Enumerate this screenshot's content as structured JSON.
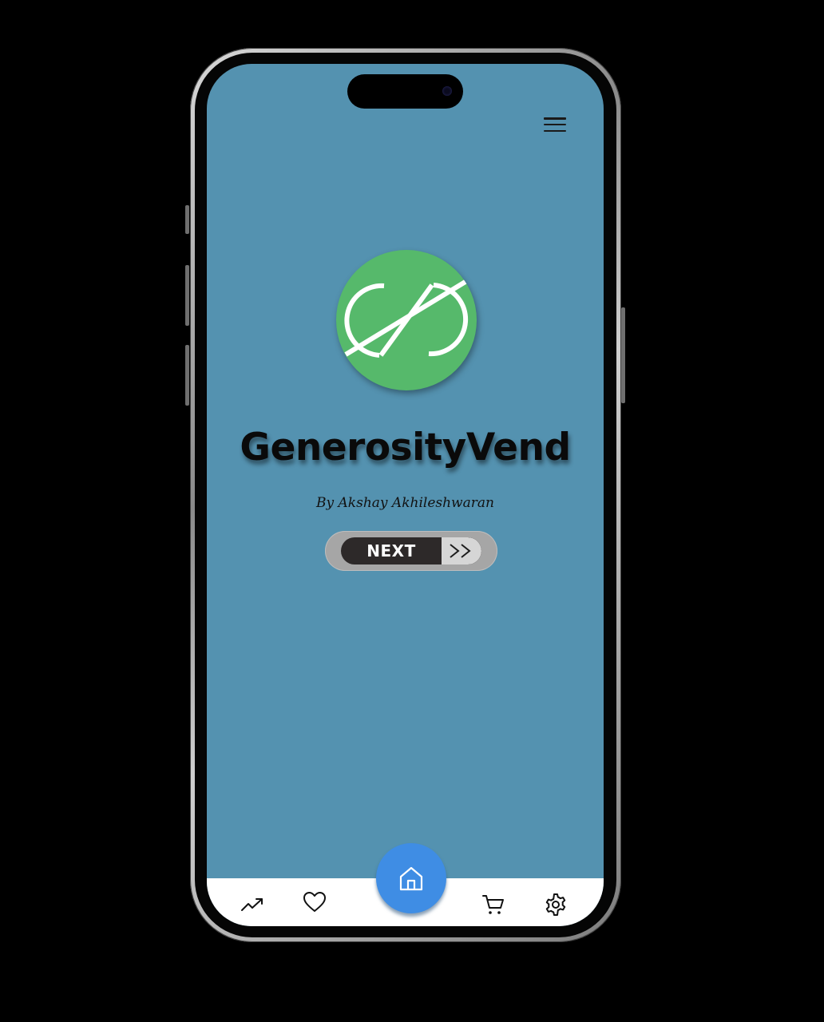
{
  "app": {
    "title": "GenerosityVend",
    "byline": "By Akshay Akhileshwaran"
  },
  "actions": {
    "next_label": "NEXT",
    "next_arrow": ">>"
  },
  "header": {
    "menu_icon": "hamburger-menu-icon"
  },
  "bottom_nav": {
    "items": [
      {
        "icon": "trending-up-icon"
      },
      {
        "icon": "heart-icon"
      },
      {
        "icon": "home-icon",
        "active": true
      },
      {
        "icon": "cart-icon"
      },
      {
        "icon": "settings-gear-icon"
      }
    ]
  },
  "colors": {
    "background": "#5492b0",
    "logo": "#56b96b",
    "home_button": "#3f8de4",
    "next_button": "#2d2929"
  }
}
